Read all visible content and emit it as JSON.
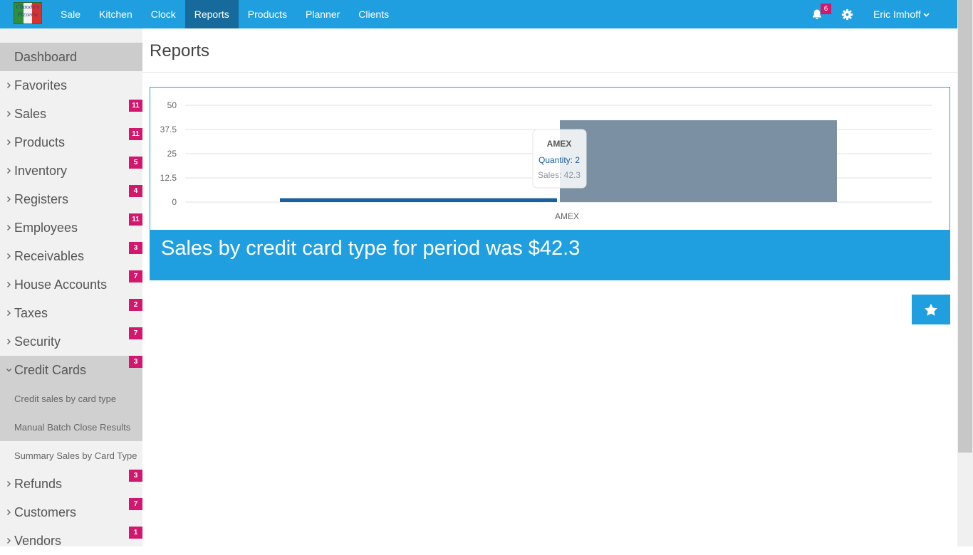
{
  "brand": {
    "logo_text": "Chaudo's Pizzeria"
  },
  "nav": {
    "items": [
      {
        "label": "Sale"
      },
      {
        "label": "Kitchen"
      },
      {
        "label": "Clock"
      },
      {
        "label": "Reports"
      },
      {
        "label": "Products"
      },
      {
        "label": "Planner"
      },
      {
        "label": "Clients"
      }
    ],
    "active": "Reports",
    "notifications": "6",
    "user": "Eric Imhoff"
  },
  "sidebar": {
    "dashboard": "Dashboard",
    "items": [
      {
        "label": "Favorites",
        "count": ""
      },
      {
        "label": "Sales",
        "count": "11"
      },
      {
        "label": "Products",
        "count": "11"
      },
      {
        "label": "Inventory",
        "count": "5"
      },
      {
        "label": "Registers",
        "count": "4"
      },
      {
        "label": "Employees",
        "count": "11"
      },
      {
        "label": "Receivables",
        "count": "3"
      },
      {
        "label": "House Accounts",
        "count": "7"
      },
      {
        "label": "Taxes",
        "count": "2"
      },
      {
        "label": "Security",
        "count": "7"
      },
      {
        "label": "Credit Cards",
        "count": "3"
      },
      {
        "label": "Refunds",
        "count": "3"
      },
      {
        "label": "Customers",
        "count": "7"
      },
      {
        "label": "Vendors",
        "count": "1"
      }
    ],
    "sub_items": [
      {
        "label": "Credit sales by card type"
      },
      {
        "label": "Manual Batch Close Results"
      },
      {
        "label": "Summary Sales by Card Type"
      }
    ]
  },
  "page": {
    "title": "Reports"
  },
  "report": {
    "summary": "Sales by credit card type for period was $42.3",
    "colors": {
      "accent": "#1f9fe0",
      "quantity_bar": "#1a5fa0",
      "sales_bar": "#7b90a2"
    }
  },
  "chart_data": {
    "type": "bar",
    "categories": [
      "AMEX"
    ],
    "series": [
      {
        "name": "Quantity",
        "values": [
          2
        ]
      },
      {
        "name": "Sales",
        "values": [
          42.3
        ]
      }
    ],
    "yticks": [
      "50",
      "37.5",
      "25",
      "12.5",
      "0"
    ],
    "ylim": [
      0,
      50
    ],
    "grid": true,
    "tooltip": {
      "title": "AMEX",
      "line1": "Quantity: 2",
      "line2": "Sales: 42.3"
    }
  }
}
